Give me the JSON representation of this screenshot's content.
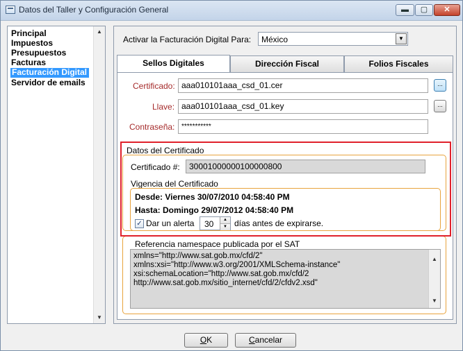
{
  "window": {
    "title": "Datos del Taller y Configuración General",
    "controls": {
      "minimize": "▬",
      "maximize": "▢",
      "close": "✕"
    }
  },
  "sidebar": {
    "items": [
      {
        "label": "Principal"
      },
      {
        "label": "Impuestos"
      },
      {
        "label": "Presupuestos"
      },
      {
        "label": "Facturas"
      },
      {
        "label": "Facturación Digital",
        "selected": true
      },
      {
        "label": "Servidor de emails"
      }
    ]
  },
  "activation": {
    "label": "Activar la Facturación Digital Para:",
    "value": "México"
  },
  "tabs": [
    {
      "label": "Sellos Digitales",
      "active": true
    },
    {
      "label": "Dirección Fiscal"
    },
    {
      "label": "Folios Fiscales"
    }
  ],
  "sellos": {
    "certificado_label": "Certificado:",
    "certificado_value": "aaa010101aaa_csd_01.cer",
    "llave_label": "Llave:",
    "llave_value": "aaa010101aaa_csd_01.key",
    "contrasena_label": "Contraseña:",
    "contrasena_value": "***********",
    "browse_label": "..."
  },
  "datos_certificado": {
    "title": "Datos del Certificado",
    "numero_label": "Certificado #:",
    "numero_value": "30001000000100000800",
    "vigencia_title": "Vigencia del Certificado",
    "desde": "Desde: Viernes 30/07/2010 04:58:40 PM",
    "hasta": "Hasta: Domingo 29/07/2012 04:58:40 PM",
    "alerta_checked": true,
    "alerta_label_pre": "Dar un alerta",
    "alerta_days": "30",
    "alerta_label_post": "días antes de expirarse."
  },
  "namespace": {
    "title": "Referencia namespace publicada por el SAT",
    "lines": [
      "xmlns=\"http://www.sat.gob.mx/cfd/2\"",
      "xmlns:xsi=\"http://www.w3.org/2001/XMLSchema-instance\"",
      "xsi:schemaLocation=\"http://www.sat.gob.mx/cfd/2",
      "http://www.sat.gob.mx/sitio_internet/cfd/2/cfdv2.xsd\""
    ]
  },
  "footer": {
    "ok_mnemonic": "O",
    "ok_rest": "K",
    "cancel_mnemonic": "C",
    "cancel_rest": "ancelar"
  },
  "colors": {
    "selection": "#3399ff",
    "group_border": "#e8a33c",
    "highlight_box": "#e0202a",
    "label_red": "#a52a2a"
  }
}
